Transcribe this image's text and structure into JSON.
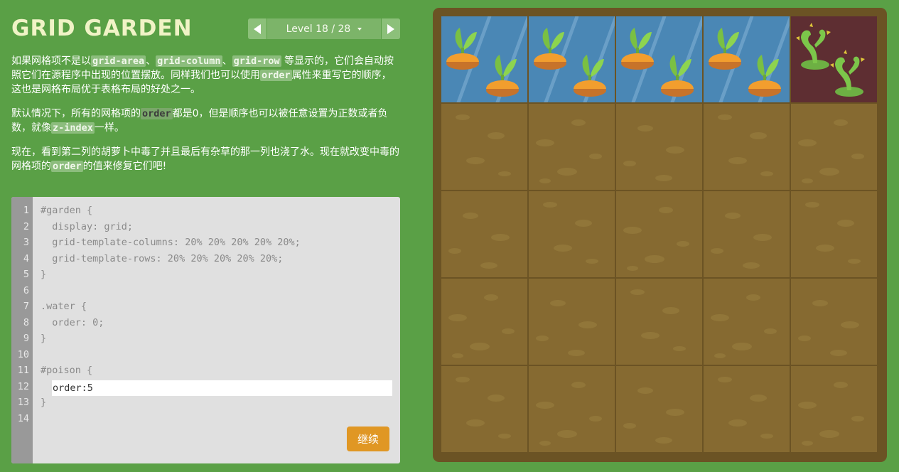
{
  "app": {
    "title": "GRID GARDEN"
  },
  "level_nav": {
    "label": "Level 18 / 28"
  },
  "instructions": {
    "p1_a": "如果网格项不是以",
    "kw_grid_area": "grid-area",
    "sep1": "、",
    "kw_grid_column": "grid-column",
    "sep2": "、",
    "kw_grid_row": "grid-row",
    "p1_b": " 等显示的，它们会自动按照它们在源程序中出现的位置摆放。同样我们也可以使用",
    "kw_order": "order",
    "p1_c": "属性来重写它的顺序，这也是网格布局优于表格布局的好处之一。",
    "p2_a": "默认情况下，所有的网格项的",
    "kw_order2": "order",
    "p2_b": "都是0，但是顺序也可以被任意设置为正数或者负数，就像",
    "kw_zindex": "z-index",
    "p2_c": "一样。",
    "p3_a": "现在，看到第二列的胡萝卜中毒了并且最后有杂草的那一列也浇了水。现在就改变中毒的网格项的",
    "kw_order3": "order",
    "p3_b": "的值来修复它们吧!"
  },
  "editor": {
    "line_numbers": [
      "1",
      "2",
      "3",
      "4",
      "5",
      "6",
      "7",
      "8",
      "9",
      "10",
      "11",
      "12",
      "13",
      "14"
    ],
    "lines": [
      "#garden {",
      "  display: grid;",
      "  grid-template-columns: 20% 20% 20% 20% 20%;",
      "  grid-template-rows: 20% 20% 20% 20% 20%;",
      "}",
      "",
      ".water {",
      "  order: 0;",
      "}",
      "",
      "#poison {",
      "",
      "}",
      ""
    ],
    "input_value": "order:5",
    "next_button_label": "继续"
  },
  "garden": {
    "columns": 5,
    "rows": 5,
    "row1": [
      "water",
      "water",
      "water",
      "water",
      "poison"
    ]
  },
  "colors": {
    "background": "#5aa046",
    "title": "#f0f3c6",
    "water": "#4a87b5",
    "poison": "#5e2e32",
    "soil": "#866a31",
    "button": "#e09724"
  }
}
